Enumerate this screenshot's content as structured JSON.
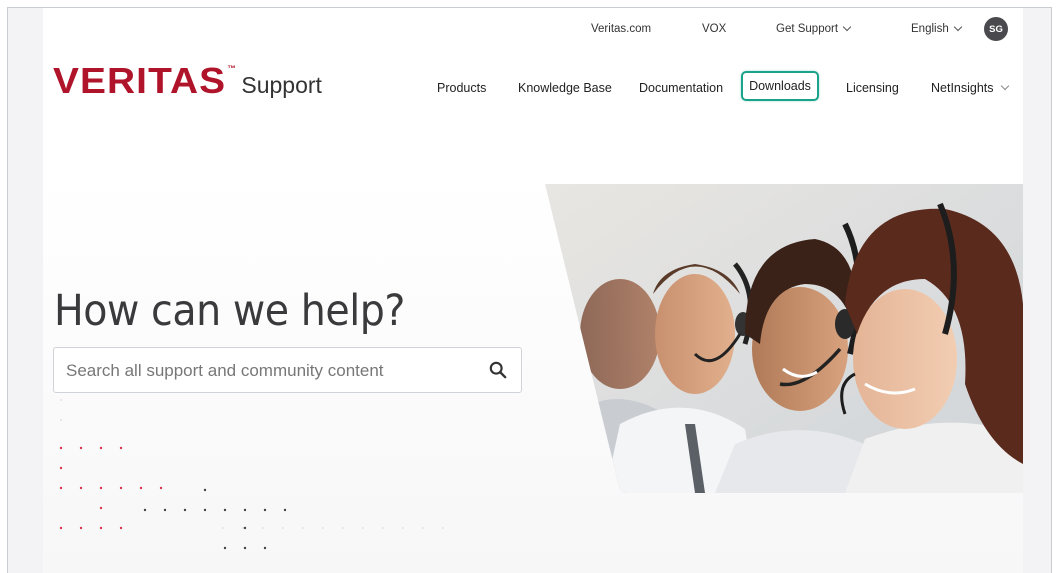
{
  "utility": {
    "veritas_link": "Veritas.com",
    "vox_link": "VOX",
    "get_support": "Get Support",
    "language": "English",
    "avatar_initials": "SG"
  },
  "brand": {
    "logo_text": "VERITAS",
    "subtitle": "Support"
  },
  "nav": {
    "products": "Products",
    "knowledge_base": "Knowledge Base",
    "documentation": "Documentation",
    "downloads": "Downloads",
    "licensing": "Licensing",
    "netinsights": "NetInsights"
  },
  "hero": {
    "title": "How can we help?",
    "search_placeholder": "Search all support and community content",
    "search_value": ""
  },
  "colors": {
    "brand_red": "#b0142a",
    "active_outline": "#1aa38a",
    "text_dark": "#222222"
  },
  "icons": {
    "search": "search-icon",
    "chevron": "chevron-down-icon"
  }
}
